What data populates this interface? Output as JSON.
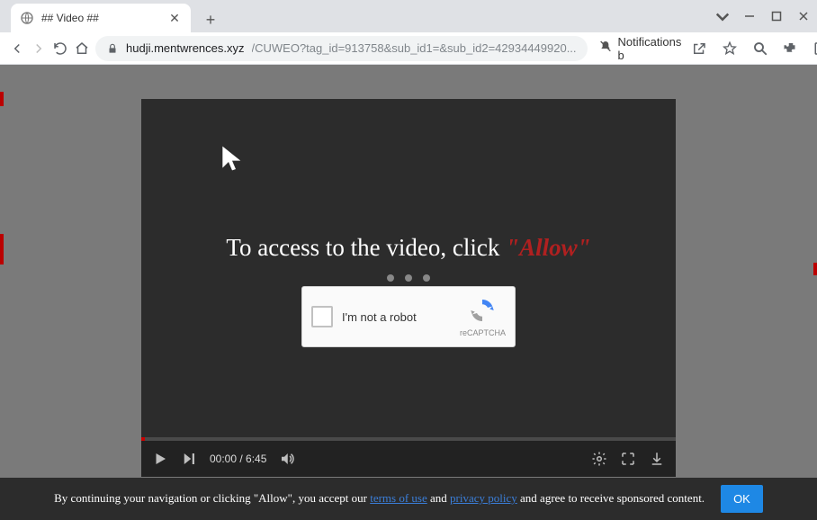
{
  "tab": {
    "title": "## Video ##"
  },
  "url": {
    "domain": "hudji.mentwrences.xyz",
    "path": "/CUWEO?tag_id=913758&sub_id1=&sub_id2=42934449920..."
  },
  "notification_chip": "Notifications b",
  "video": {
    "message_main": "To access to the video, click ",
    "message_allow": "\"Allow\"",
    "recaptcha_label": "I'm not a robot",
    "recaptcha_brand": "reCAPTCHA",
    "time_current": "00:00",
    "time_separator": " / ",
    "time_total": "6:45"
  },
  "consent": {
    "prefix": "By continuing your navigation or clicking \"Allow\", you accept our ",
    "link1": "terms of use",
    "mid1": " and ",
    "link2": "privacy policy",
    "suffix": " and agree to receive sponsored content.",
    "ok": "OK"
  }
}
